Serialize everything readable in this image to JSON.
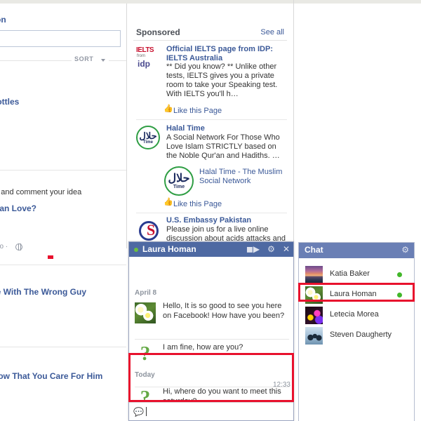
{
  "left_column": {
    "section_title": "on",
    "search_value": "",
    "sort_label": "SORT",
    "items": [
      {
        "type": "link",
        "text": "ng bottles"
      },
      {
        "type": "text",
        "text": "ad and comment your idea"
      },
      {
        "type": "link",
        "text": "han Love?"
      },
      {
        "type": "meta",
        "text": "go ·"
      },
      {
        "type": "link",
        "text": "ve With The Wrong Guy"
      },
      {
        "type": "link",
        "text": "how That You Care For Him"
      }
    ]
  },
  "sponsored": {
    "header_title": "Sponsored",
    "see_all_label": "See all",
    "ads": [
      {
        "logo": "ielts-logo",
        "logo_text": "IELTS",
        "logo_sub": "from",
        "logo_sub2": "idp",
        "title": "Official IELTS page from IDP: IELTS Australia",
        "description": "** Did you know? ** Unlike other tests, IELTS gives you a private room to take your Speaking test. With IELTS you'll h…",
        "like_label": "Like this Page"
      },
      {
        "logo": "halal-time-logo",
        "logo_text": "Time",
        "title": "Halal Time",
        "description": "A Social Network For Those Who Love Islam STRICTLY based on the Noble Qur'an and Hadiths. …",
        "sub_title": "Halal Time - The Muslim Social Network",
        "like_label": "Like this Page"
      },
      {
        "logo": "us-embassy-logo",
        "title": "U.S. Embassy Pakistan",
        "description": "Please join us for a live online discussion about acids attacks and"
      }
    ]
  },
  "chat_window": {
    "contact_name": "Laura Homan",
    "online": true,
    "icons": [
      "video-call-icon",
      "gear-icon",
      "close-icon"
    ],
    "day_separators": [
      "April 8",
      "Today"
    ],
    "messages": [
      {
        "avatar": "flower-avatar",
        "text": "Hello,\nIt is so good to see you here on Facebook! How have you been?",
        "time": "",
        "day": "April 8"
      },
      {
        "avatar": "question-mark-avatar",
        "text": "I am fine, how are you?",
        "time": "",
        "day": "April 8"
      },
      {
        "avatar": "question-mark-avatar",
        "text": "Hi, where do you want to meet this saturday?",
        "time": "12:33",
        "day": "Today"
      }
    ],
    "input": {
      "value": "",
      "placeholder": ""
    }
  },
  "chat_sidebar": {
    "title": "Chat",
    "gear_icon": "gear-icon",
    "contacts": [
      {
        "name": "Katia Baker",
        "online": true,
        "avatar": "sunset-avatar"
      },
      {
        "name": "Laura Homan",
        "online": true,
        "avatar": "flower-avatar"
      },
      {
        "name": "Letecia Morea",
        "online": false,
        "avatar": "neon-avatar"
      },
      {
        "name": "Steven Daugherty",
        "online": false,
        "avatar": "penguin-avatar"
      }
    ]
  },
  "annotations": {
    "highlight_color": "#e8112d",
    "boxes": [
      {
        "name": "message-highlight",
        "target": "latest message in chat window"
      },
      {
        "name": "contact-highlight",
        "target": "Laura Homan in chat sidebar"
      }
    ]
  }
}
